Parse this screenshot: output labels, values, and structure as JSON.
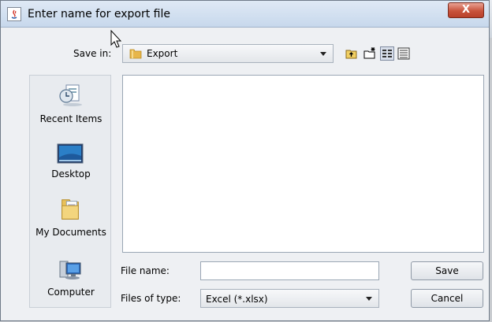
{
  "dialog": {
    "title": "Enter name for export file",
    "close_label": "X"
  },
  "save_in": {
    "label": "Save in:",
    "value": "Export"
  },
  "toolbar": {
    "icons": [
      "up-one-level-icon",
      "create-new-folder-icon",
      "list-view-icon",
      "details-view-icon"
    ]
  },
  "places": [
    {
      "label": "Recent Items",
      "icon": "recent-items-icon"
    },
    {
      "label": "Desktop",
      "icon": "desktop-icon"
    },
    {
      "label": "My Documents",
      "icon": "my-documents-icon"
    },
    {
      "label": "Computer",
      "icon": "computer-icon"
    }
  ],
  "file_name": {
    "label": "File name:",
    "value": ""
  },
  "file_type": {
    "label": "Files of type:",
    "value": "Excel (*.xlsx)"
  },
  "buttons": {
    "save": "Save",
    "cancel": "Cancel"
  },
  "colors": {
    "title_bar": "#c7d8ec",
    "close_button": "#c8533c",
    "dialog_bg": "#eef0f3"
  }
}
